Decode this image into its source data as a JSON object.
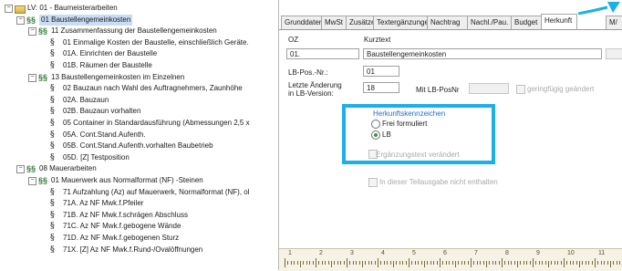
{
  "tree": {
    "items": [
      {
        "label": "LV: 01 - Baumeisterarbeiten",
        "icon": "folder",
        "level": 0,
        "toggle": "-"
      },
      {
        "label": "01 Baustellengemeinkosten",
        "icon": "group",
        "level": 1,
        "toggle": "-",
        "selected": true
      },
      {
        "label": "11 Zusammenfassung der Baustellengemeinkosten",
        "icon": "group",
        "level": 2,
        "toggle": "-"
      },
      {
        "label": "01 Einmalige Kosten der Baustelle, einschließlich Geräte.",
        "icon": "position",
        "level": 3
      },
      {
        "label": "01A. Einrichten der Baustelle",
        "icon": "position",
        "level": 3
      },
      {
        "label": "01B. Räumen der Baustelle",
        "icon": "position",
        "level": 3
      },
      {
        "label": "13 Baustellengemeinkosten im Einzelnen",
        "icon": "group",
        "level": 2,
        "toggle": "-"
      },
      {
        "label": "02 Bauzaun nach Wahl des Auftragnehmers, Zaunhöhe",
        "icon": "position",
        "level": 3
      },
      {
        "label": "02A. Bauzaun",
        "icon": "position",
        "level": 3
      },
      {
        "label": "02B. Bauzaun vorhalten",
        "icon": "position",
        "level": 3
      },
      {
        "label": "05 Container in Standardausführung (Abmessungen 2,5 x",
        "icon": "position",
        "level": 3
      },
      {
        "label": "05A. Cont.Stand.Aufenth.",
        "icon": "position",
        "level": 3
      },
      {
        "label": "05B. Cont.Stand.Aufenth.vorhalten Baubetrieb",
        "icon": "position",
        "level": 3
      },
      {
        "label": "05D. [Z] Testposition",
        "icon": "position",
        "level": 3
      },
      {
        "label": "08 Mauerarbeiten",
        "icon": "group",
        "level": 1,
        "toggle": "-"
      },
      {
        "label": "01 Mauerwerk aus Normalformat (NF) -Steinen",
        "icon": "group",
        "level": 2,
        "toggle": "-"
      },
      {
        "label": "71 Aufzahlung (Az) auf Mauerwerk, Normalformat (NF), ol",
        "icon": "position",
        "level": 3
      },
      {
        "label": "71A. Az NF Mwk.f.Pfeiler",
        "icon": "position",
        "level": 3
      },
      {
        "label": "71B. Az NF Mwk.f.schrägen Abschluss",
        "icon": "position",
        "level": 3
      },
      {
        "label": "71C. Az NF Mwk.f.gebogene Wände",
        "icon": "position",
        "level": 3
      },
      {
        "label": "71D. Az NF Mwk.f.gebogenen Sturz",
        "icon": "position",
        "level": 3
      },
      {
        "label": "71X. [Z] Az NF Mwk.f.Rund-/Ovalöffnungen",
        "icon": "position",
        "level": 3
      }
    ]
  },
  "tabs": [
    "Grunddaten",
    "MwSt",
    "Zusätze",
    "Textergänzungen",
    "Nachtrag",
    "Nachl./Pau.",
    "Budget",
    "Herkunft",
    "M/"
  ],
  "active_tab": "Herkunft",
  "form": {
    "oz_label": "OZ",
    "oz_value": "01.",
    "kurztext_label": "Kurztext",
    "kurztext_value": "Baustellengemeinkosten",
    "lbpos_label": "LB-Pos.-Nr.:",
    "lbpos_value": "01",
    "letzte_label_1": "Letzte Änderung",
    "letzte_label_2": "in LB-Version:",
    "letzte_value": "18",
    "mit_lbposnr_label": "Mit LB-PosNr",
    "geringfuegig_label": "geringfügig geändert",
    "herkunft_title": "Herkunftskennzeichen",
    "radio_frei": "Frei formuliert",
    "radio_lb": "LB",
    "radio_selected": "LB",
    "erg_label": "Ergänzungstext verändert",
    "teilausgabe_label": "In dieser Teilausgabe nicht enthalten"
  },
  "ruler": [
    "1",
    "2",
    "3",
    "4",
    "5",
    "6",
    "7",
    "8",
    "9",
    "10",
    "11"
  ],
  "colors": {
    "highlight": "#1ab0e8",
    "arrow": "#1ab0e8",
    "selection": "#c9dcf5",
    "group_title": "#2a6bc5"
  }
}
